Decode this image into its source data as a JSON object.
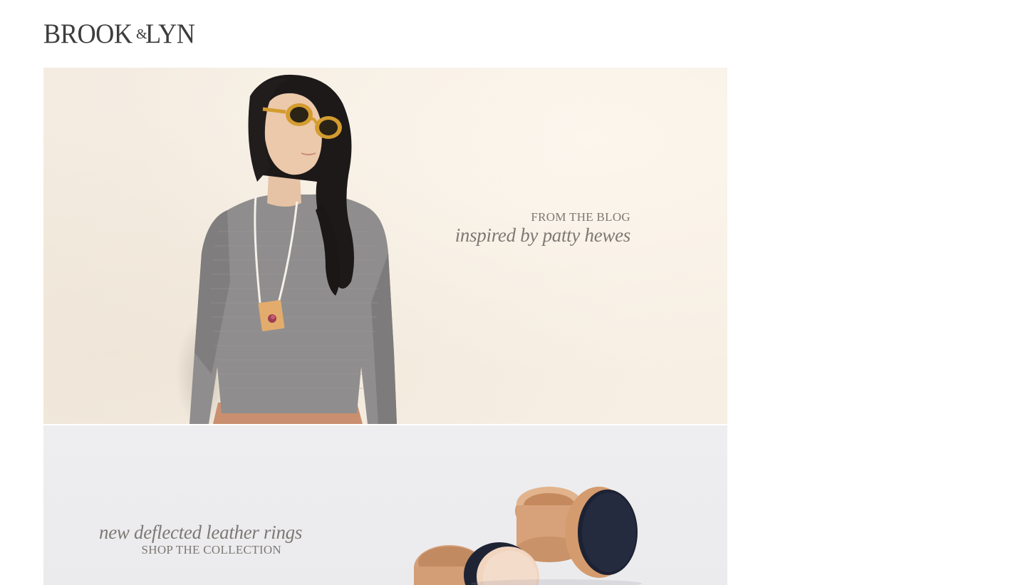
{
  "brand": {
    "logo_word1": "BROOK",
    "logo_amp": "&",
    "logo_word2": "LYN"
  },
  "hero": {
    "kicker": "FROM THE BLOG",
    "headline": "inspired by patty hewes",
    "colors": {
      "wall": "#f6eee3",
      "sweater": "#8e8c8c",
      "hair": "#1e1a1a",
      "sunglasses": "#d39a2e",
      "pendant": "#e0a866",
      "skin": "#e9c7aa"
    }
  },
  "rings_panel": {
    "headline": "new deflected leather rings",
    "kicker": "SHOP THE COLLECTION",
    "colors": {
      "background": "#ededef",
      "leather": "#d8a277",
      "navy": "#1c2233",
      "natural": "#f0d4bd"
    }
  },
  "icons": {
    "logo": "brand-logo-icon"
  }
}
